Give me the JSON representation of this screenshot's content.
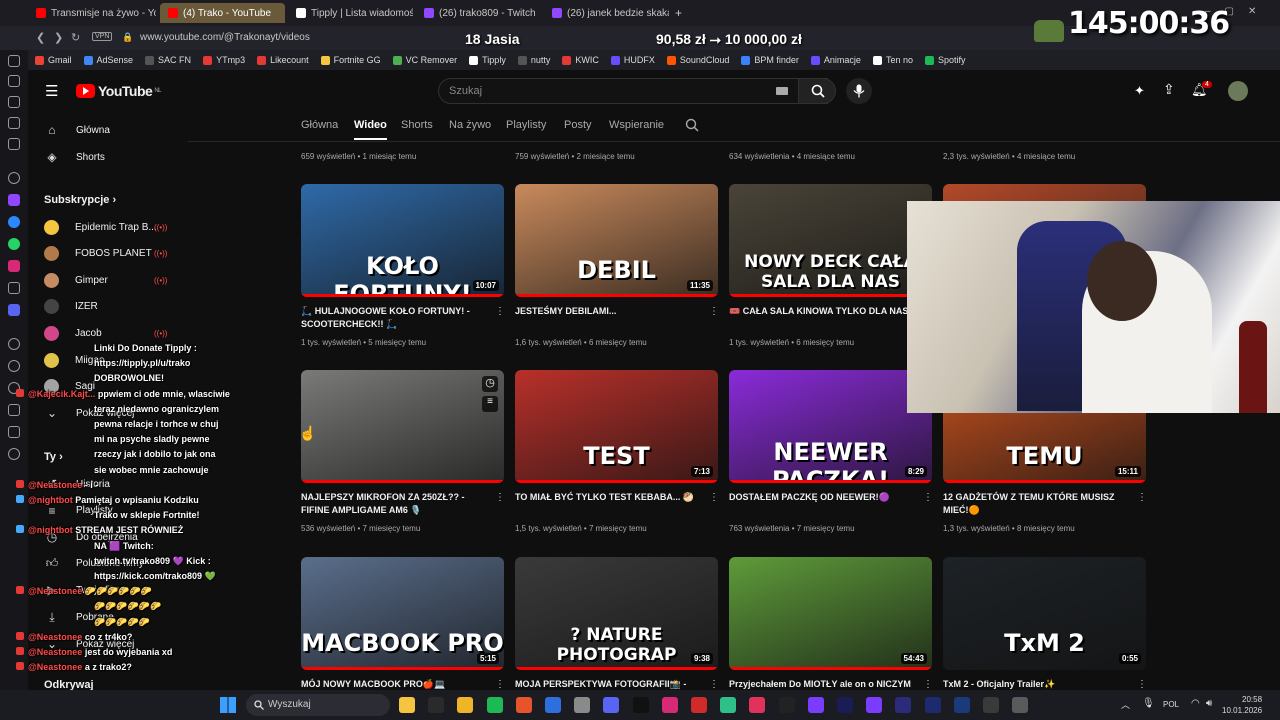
{
  "browser": {
    "tabs": [
      {
        "label": "Transmisje na żywo - YouT",
        "color": "#ff0000"
      },
      {
        "label": "(4) Trako - YouTube",
        "color": "#ff0000"
      },
      {
        "label": "Tipply | Lista wiadomości",
        "color": "#ffffff"
      },
      {
        "label": "(26) trako809 - Twitch",
        "color": "#9146ff"
      },
      {
        "label": "(26) janek bedzie skaka! -",
        "color": "#9146ff"
      }
    ],
    "new_tab": "+",
    "vpn": "VPN",
    "url": "www.youtube.com/@Trakonayt/videos"
  },
  "bookmarks": [
    {
      "label": "Gmail",
      "color": "#ea4335"
    },
    {
      "label": "AdSense",
      "color": "#4285f4"
    },
    {
      "label": "SAC FN",
      "color": "#555555"
    },
    {
      "label": "YTmp3",
      "color": "#e53935"
    },
    {
      "label": "Likecount",
      "color": "#e53935"
    },
    {
      "label": "Fortnite GG",
      "color": "#f5c542"
    },
    {
      "label": "VC Remover",
      "color": "#4caf50"
    },
    {
      "label": "Tipply",
      "color": "#ffffff"
    },
    {
      "label": "nutty",
      "color": "#555555"
    },
    {
      "label": "KWIC",
      "color": "#e53935"
    },
    {
      "label": "HUDFX",
      "color": "#6a4cff"
    },
    {
      "label": "SoundCloud",
      "color": "#ff5500"
    },
    {
      "label": "BPM finder",
      "color": "#3b82f6"
    },
    {
      "label": "Animacje",
      "color": "#6a4cff"
    },
    {
      "label": "Ten no",
      "color": "#ffffff"
    },
    {
      "label": "Spotify",
      "color": "#1db954"
    }
  ],
  "overlay": {
    "title": "18 Jasia",
    "money_current": "90,58 zł",
    "money_sep": "⭢",
    "money_goal": "10 000,00 zł",
    "timer": "145:00:36"
  },
  "youtube": {
    "logo": "YouTube",
    "region": "NL",
    "search_placeholder": "Szukaj",
    "notifications": "4"
  },
  "sidebar": {
    "main": [
      {
        "label": "Główna"
      },
      {
        "label": "Shorts"
      }
    ],
    "subs_heading": "Subskrypcje",
    "subs": [
      {
        "label": "Epidemic Trap B...",
        "color": "#f5c542",
        "live": true
      },
      {
        "label": "FOBOS PLANET",
        "color": "#b07a4a",
        "live": true
      },
      {
        "label": "Gimper",
        "color": "#c58b63",
        "live": true
      },
      {
        "label": "IZER",
        "color": "#444444",
        "live": false
      },
      {
        "label": "Jacob",
        "color": "#d1478a",
        "live": true
      },
      {
        "label": "Miigao",
        "color": "#e0c34a",
        "live": false
      },
      {
        "label": "Sagi",
        "color": "#a3a3a3",
        "live": false
      }
    ],
    "show_more": "Pokaż więcej",
    "you_heading": "Ty",
    "you": [
      {
        "label": "Historia"
      },
      {
        "label": "Playlisty"
      },
      {
        "label": "Do obejrzenia"
      },
      {
        "label": "Polubione filmy"
      },
      {
        "label": "Twoje filmy"
      },
      {
        "label": "Pobrane"
      }
    ],
    "show_more_2": "Pokaż więcej",
    "explore_heading": "Odkrywaj"
  },
  "channel_tabs": [
    "Główna",
    "Wideo",
    "Shorts",
    "Na żywo",
    "Playlisty",
    "Posty",
    "Wspieranie"
  ],
  "top_row_meta": [
    "659 wyświetleń • 1 miesiąc temu",
    "759 wyświetleń • 2 miesiące temu",
    "634 wyświetlenia • 4 miesiące temu",
    "2,3 tys. wyświetleń • 4 miesiące temu"
  ],
  "videos": [
    {
      "title": "🛴 HULAJNOGOWE KOŁO FORTUNY! - SCOOTERCHECK!! 🛴",
      "meta": "1 tys. wyświetleń • 5 miesięcy temu",
      "duration": "10:07",
      "big": "KOŁO FORTUNY!",
      "bg": "#2f6aa8",
      "watched": 1.0
    },
    {
      "title": "JESTEŚMY DEBILAMI...",
      "meta": "1,6 tys. wyświetleń • 6 miesięcy temu",
      "duration": "11:35",
      "big": "DEBIL",
      "bg": "#c98a5c",
      "watched": 1.0
    },
    {
      "title": "🎟️ CAŁA SALA KINOWA TYLKO DLA NAS!",
      "meta": "1 tys. wyświetleń • 6 miesięcy temu",
      "duration": "",
      "big": "NOWY DECK   CAŁA SALA DLA NAS",
      "bg": "#4a4438",
      "watched": 1.0
    },
    {
      "title": "",
      "meta": "",
      "duration": "",
      "big": "",
      "bg": "#b34a2a",
      "watched": 1.0
    },
    {
      "title": "NAJLEPSZY MIKROFON ZA 250ZŁ?? - FIFINE AMPLIGAME AM6 🎙️",
      "meta": "536 wyświetleń • 7 miesięcy temu",
      "duration": "",
      "big": "",
      "bg": "#7a7a78",
      "watched": 1.0
    },
    {
      "title": "TO MIAŁ BYĆ TYLKO TEST KEBABA... 🥙",
      "meta": "1,5 tys. wyświetleń • 7 miesięcy temu",
      "duration": "7:13",
      "big": "TEST",
      "bg": "#b9302a",
      "watched": 1.0
    },
    {
      "title": "DOSTAŁEM PACZKĘ OD NEEWER!🟣",
      "meta": "763 wyświetlenia • 7 miesięcy temu",
      "duration": "8:29",
      "big": "NEEWER PACZKA!",
      "bg": "#8a2bd9",
      "watched": 1.0
    },
    {
      "title": "12 GADŻETÓW Z TEMU KTÓRE MUSISZ MIEĆ!🟠",
      "meta": "1,3 tys. wyświetleń • 8 miesięcy temu",
      "duration": "15:11",
      "big": "TEMU",
      "bg": "#c4501f",
      "watched": 1.0
    },
    {
      "title": "MÓJ NOWY MACBOOK PRO🍎💻",
      "meta": "",
      "duration": "5:15",
      "big": "MACBOOK PRO",
      "bg": "#5a6e8c",
      "watched": 1.0
    },
    {
      "title": "MOJA PERSPEKTYWA FOTOGRAFII📸 -",
      "meta": "",
      "duration": "9:38",
      "big": "? NATURE PHOTOGRAP",
      "bg": "#3a3a3a",
      "watched": 1.0
    },
    {
      "title": "Przyjechałem Do MIOTŁY ale on o NICZYM",
      "meta": "",
      "duration": "54:43",
      "big": "",
      "bg": "#5e9b3a",
      "watched": 1.0
    },
    {
      "title": "TxM 2 - Oficjalny Trailer✨",
      "meta": "",
      "duration": "0:55",
      "big": "TxM 2",
      "bg": "#1d2226",
      "watched": 0.0
    }
  ],
  "chat": [
    {
      "user": "",
      "text": "Linki Do Donate Tipply :"
    },
    {
      "user": "",
      "text": "https://tipply.pl/u/trako"
    },
    {
      "user": "",
      "text": "DOBROWOLNE!"
    },
    {
      "user": "@Kajecik.Kajt...",
      "text": "ppwiem ci ode mnie, wlasciwie"
    },
    {
      "user": "",
      "text": "teraz niedawno ograniczylem"
    },
    {
      "user": "",
      "text": "pewna relacje i torhce w chuj"
    },
    {
      "user": "",
      "text": "mi na psyche sladly pewne"
    },
    {
      "user": "",
      "text": "rzeczy jak i dobilo to jak ona"
    },
    {
      "user": "",
      "text": "sie wobec mnie zachowuje"
    },
    {
      "user": "@Neastonee",
      "text": "- i -"
    },
    {
      "user": "@nightbot",
      "text": "Pamiętaj o wpisaniu Kodziku"
    },
    {
      "user": "",
      "text": "Trako w sklepie Fortnite!"
    },
    {
      "user": "@nightbot",
      "text": "STREAM JEST RÓWNIEŻ"
    },
    {
      "user": "",
      "text": "NA 🟪 Twitch:"
    },
    {
      "user": "",
      "text": "twitch.tv/trako809 💜 Kick :"
    },
    {
      "user": "",
      "text": "https://kick.com/trako809 💚"
    },
    {
      "user": "@Neastonee",
      "text": "🌮🌮🌮🌮🌮🌮"
    },
    {
      "user": "",
      "text": "🌮🌮🌮🌮🌮🌮"
    },
    {
      "user": "",
      "text": "🌮🌮🌮🌮🌮"
    },
    {
      "user": "@Neastonee",
      "text": "co z tr4ko?"
    },
    {
      "user": "@Neastonee",
      "text": "jest do wyjebania xd"
    },
    {
      "user": "@Neastonee",
      "text": "a z trako2?"
    }
  ],
  "taskbar": {
    "search": "Wyszukaj",
    "lang": "POL",
    "time": "20:58",
    "date": "10.01.2026"
  }
}
